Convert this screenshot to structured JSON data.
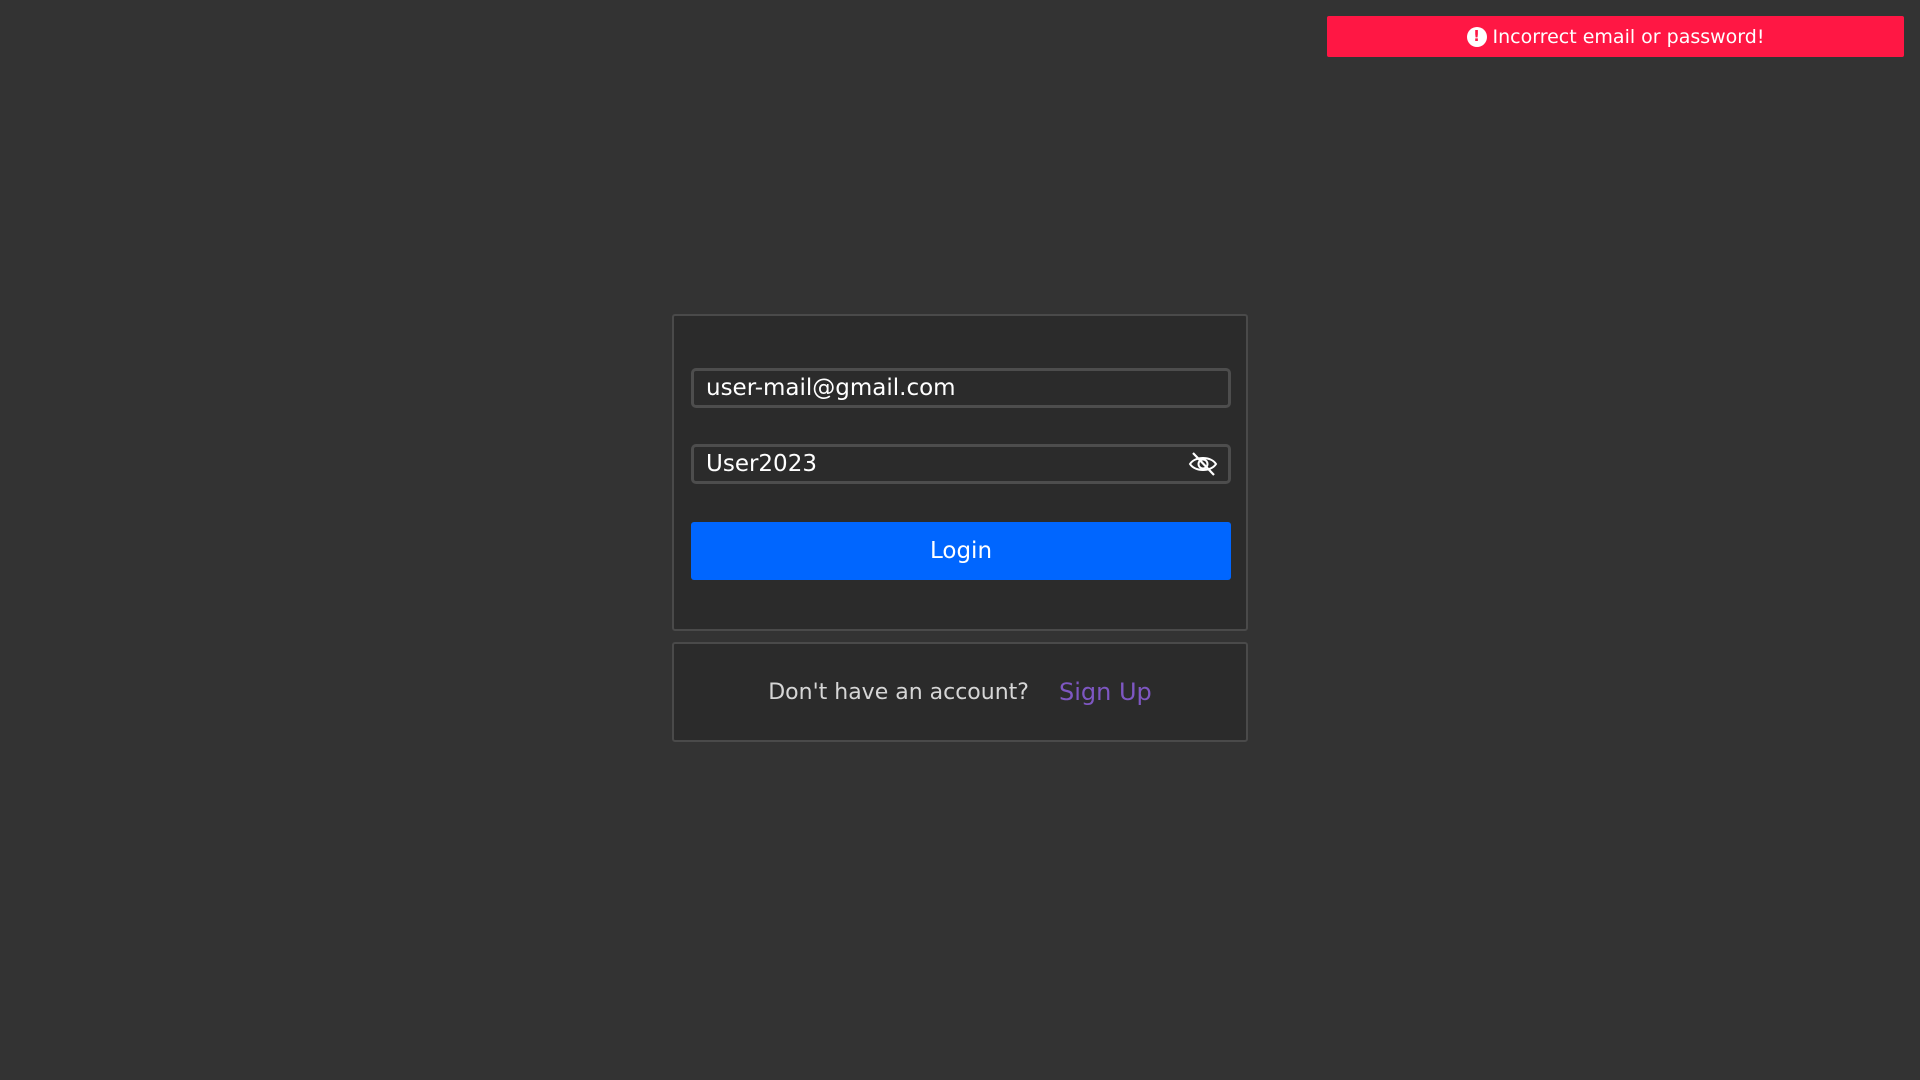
{
  "toast": {
    "message": "Incorrect email or password!",
    "icon": "alert-circle-icon",
    "icon_glyph": "!",
    "color": "#ff1744"
  },
  "login_form": {
    "email_value": "user-mail@gmail.com",
    "password_value": "User2023",
    "password_toggle_icon": "eye-slash-icon",
    "login_label": "Login",
    "login_color": "#0066ff"
  },
  "signup": {
    "prompt": "Don't have an account?",
    "link_label": "Sign Up",
    "link_color": "#7e57c2"
  }
}
